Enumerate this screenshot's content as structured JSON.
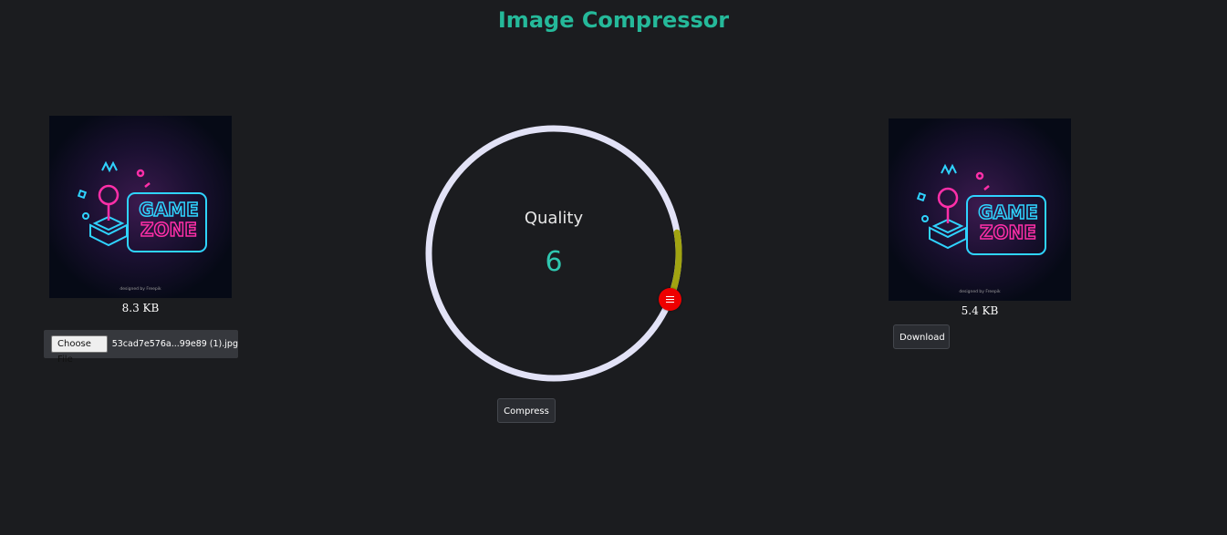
{
  "app": {
    "title": "Image Compressor"
  },
  "original": {
    "size_label": "8.3 KB",
    "file_input": {
      "button_label": "Choose File",
      "file_name": "53cad7e576a...99e89 (1).jpg"
    }
  },
  "quality": {
    "label": "Quality",
    "value": "6",
    "slider_value": 6,
    "slider_max": 100,
    "track_color": "#e2e2f6",
    "fill_color": "#a1a411",
    "knob_color": "#ee0000",
    "knob_icon": "menu-lines-icon"
  },
  "compressed": {
    "size_label": "5.4 KB"
  },
  "actions": {
    "compress_label": "Compress",
    "download_label": "Download"
  },
  "image": {
    "line1": "GAME",
    "line2": "ZONE",
    "credit": "designed by Freepik"
  },
  "colors": {
    "background": "#1b1c1f",
    "title": "#25b99a",
    "value": "#2fc7b0",
    "neon_pink": "#ff2fa8",
    "neon_cyan": "#2fd4ff"
  }
}
